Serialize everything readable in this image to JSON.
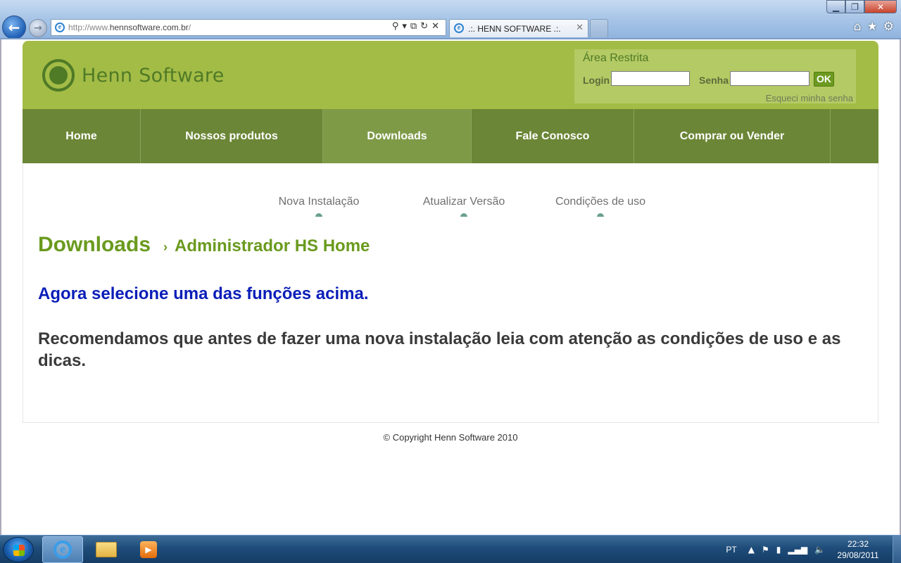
{
  "browser": {
    "address": {
      "prefix": "http://www.",
      "domain": "hennsoftware.com.br",
      "suffix": "/"
    },
    "tab_title": ".:. HENN SOFTWARE .:.",
    "tab_close": "✕",
    "icons": [
      "search-icon",
      "dropdown-icon",
      "compatibility-icon",
      "refresh-icon",
      "stop-icon",
      "home-icon",
      "favorites-icon",
      "tools-icon"
    ]
  },
  "header": {
    "logo_text": "Henn Software",
    "login_box": {
      "title": "Área Restrita",
      "login_label": "Login",
      "login_value": "",
      "senha_label": "Senha",
      "senha_value": "",
      "ok_label": "OK",
      "forgot_link": "Esqueci minha senha"
    }
  },
  "nav": {
    "items": [
      {
        "label": "Home"
      },
      {
        "label": "Nossos produtos"
      },
      {
        "label": "Downloads",
        "active": true
      },
      {
        "label": "Fale Conosco"
      },
      {
        "label": "Comprar ou Vender"
      }
    ]
  },
  "content": {
    "sub_links": [
      "Nova Instalação",
      "Atualizar Versão",
      "Condições de uso"
    ],
    "heading_main": "Downloads",
    "heading_sub": "Administrador HS Home",
    "instruction": "Agora selecione uma das funções acima.",
    "recommendation": "Recomendamos que antes de fazer uma nova instalação leia com atenção as condições de uso e as dicas."
  },
  "footer": {
    "copyright": "© Copyright Henn Software 2010"
  },
  "taskbar": {
    "language": "PT",
    "time": "22:32",
    "date": "29/08/2011"
  },
  "colors": {
    "header_green": "#a3bc46",
    "nav_green": "#6b8636",
    "heading_green": "#6a9a1e",
    "instruction_blue": "#0a1eb8"
  }
}
